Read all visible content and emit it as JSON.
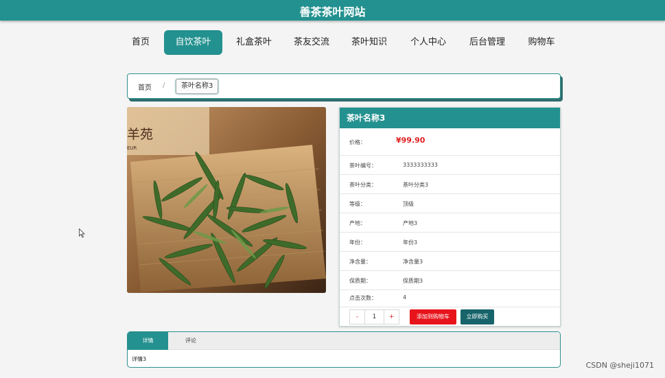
{
  "site": {
    "title": "善茶茶叶网站"
  },
  "nav": [
    {
      "label": "首页",
      "active": false
    },
    {
      "label": "自饮茶叶",
      "active": true
    },
    {
      "label": "礼盒茶叶",
      "active": false
    },
    {
      "label": "茶友交流",
      "active": false
    },
    {
      "label": "茶叶知识",
      "active": false
    },
    {
      "label": "个人中心",
      "active": false
    },
    {
      "label": "后台管理",
      "active": false
    },
    {
      "label": "购物车",
      "active": false
    }
  ],
  "breadcrumb": {
    "home": "首页",
    "sep": "/",
    "current": "茶叶名称3"
  },
  "product": {
    "name": "茶叶名称3",
    "price_label": "价格：",
    "price": "¥99.90",
    "details": [
      {
        "key": "茶叶编号：",
        "value": "3333333333"
      },
      {
        "key": "茶叶分类：",
        "value": "茶叶分类3"
      },
      {
        "key": "等级：",
        "value": "顶级"
      },
      {
        "key": "产地：",
        "value": "产地3"
      },
      {
        "key": "年份：",
        "value": "年份3"
      },
      {
        "key": "净含量：",
        "value": "净含量3"
      },
      {
        "key": "保质期：",
        "value": "保质期3"
      },
      {
        "key": "点击次数：",
        "value": "4"
      }
    ],
    "qty": {
      "minus": "-",
      "value": "1",
      "plus": "+"
    },
    "add_to_cart": "添加到购物车",
    "buy_now": "立即购买",
    "image_brand_text": "羊苑",
    "image_brand_sub": "EUR"
  },
  "tabs": {
    "items": [
      "详情",
      "评论"
    ],
    "active": 0,
    "content": "详情3"
  },
  "watermark": "CSDN @sheji1071",
  "colors": {
    "accent": "#23918f",
    "price": "#e02020",
    "cart_button": "#e8141c",
    "buy_button": "#17646a"
  }
}
